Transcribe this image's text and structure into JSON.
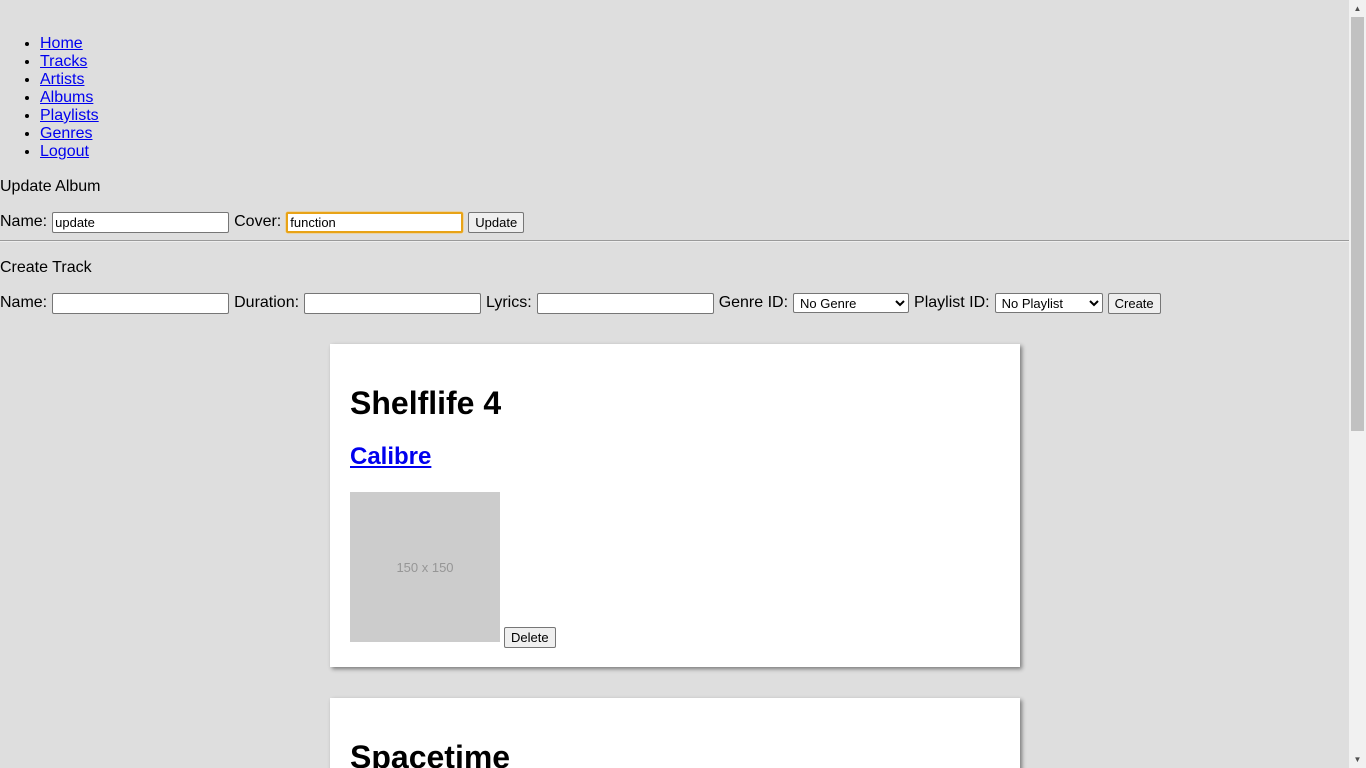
{
  "nav": {
    "items": [
      {
        "label": "Home"
      },
      {
        "label": "Tracks"
      },
      {
        "label": "Artists"
      },
      {
        "label": "Albums"
      },
      {
        "label": "Playlists"
      },
      {
        "label": "Genres"
      },
      {
        "label": "Logout"
      }
    ]
  },
  "update_album": {
    "title": "Update Album",
    "name_label": "Name:",
    "name_value": "update",
    "cover_label": "Cover:",
    "cover_value": "function",
    "submit_label": "Update"
  },
  "create_track": {
    "title": "Create Track",
    "name_label": "Name:",
    "name_value": "",
    "duration_label": "Duration:",
    "duration_value": "",
    "lyrics_label": "Lyrics:",
    "lyrics_value": "",
    "genre_label": "Genre ID:",
    "genre_selected": "No Genre",
    "playlist_label": "Playlist ID:",
    "playlist_selected": "No Playlist",
    "submit_label": "Create"
  },
  "albums": [
    {
      "title": "Shelflife 4",
      "artist": "Calibre",
      "cover_placeholder": "150 x 150",
      "delete_label": "Delete"
    },
    {
      "title": "Spacetime"
    }
  ],
  "icons": {
    "scroll_up": "scroll-up-arrow-icon",
    "scroll_down": "scroll-down-arrow-icon"
  }
}
